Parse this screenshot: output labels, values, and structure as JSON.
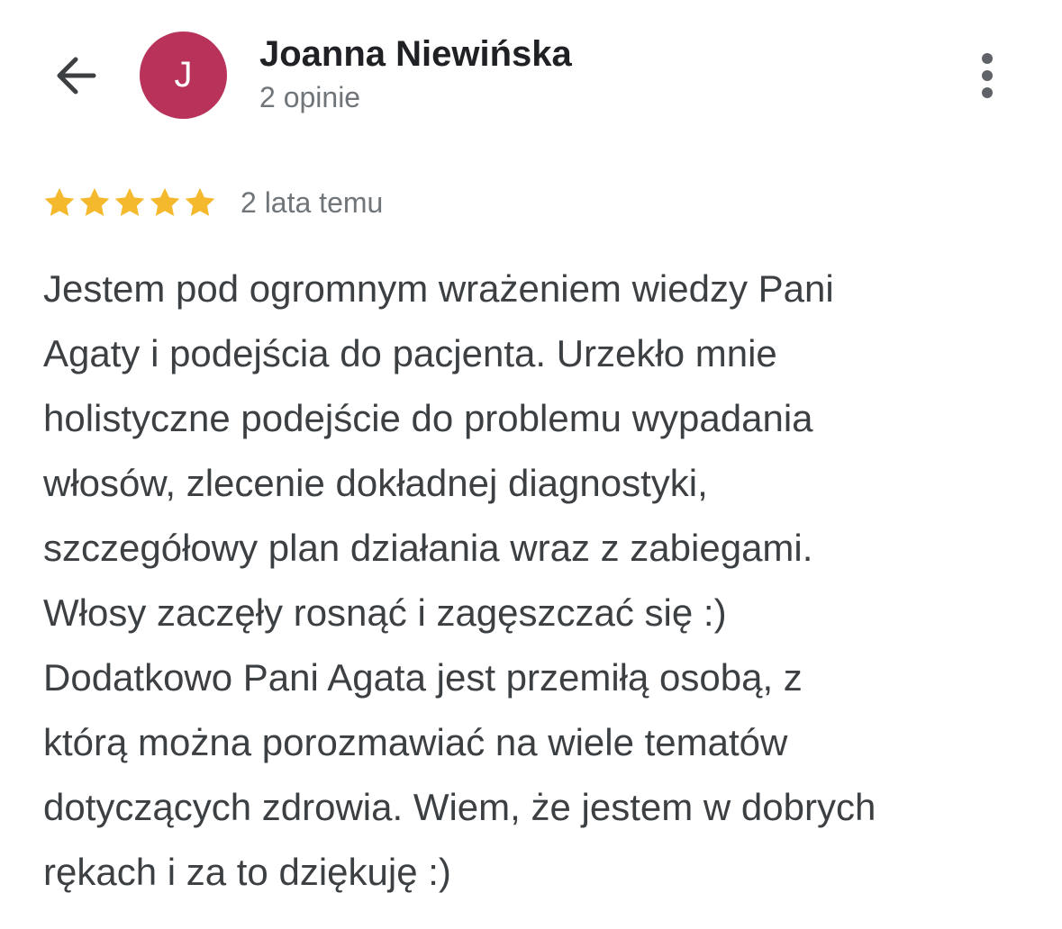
{
  "header": {
    "back_icon": "arrow-left-icon",
    "avatar_letter": "J",
    "avatar_color": "#b8325a",
    "reviewer_name": "Joanna Niewińska",
    "review_count": "2 opinie",
    "more_icon": "more-vertical-icon"
  },
  "review": {
    "rating": 5,
    "rating_max": 5,
    "star_color": "#f5b92e",
    "date": "2 lata temu",
    "lines": [
      "Jestem pod ogromnym wrażeniem wiedzy Pani",
      "Agaty i podejścia do pacjenta. Urzekło mnie",
      "holistyczne podejście do problemu wypadania",
      "włosów, zlecenie dokładnej diagnostyki,",
      "szczegółowy plan działania wraz z zabiegami.",
      "Włosy zaczęły rosnąć i zagęszczać się :)",
      "Dodatkowo Pani Agata jest przemiłą osobą, z",
      "którą można porozmawiać na wiele tematów",
      "dotyczących zdrowia. Wiem, że jestem w dobrych",
      "rękach i za to dziękuję :)"
    ]
  }
}
